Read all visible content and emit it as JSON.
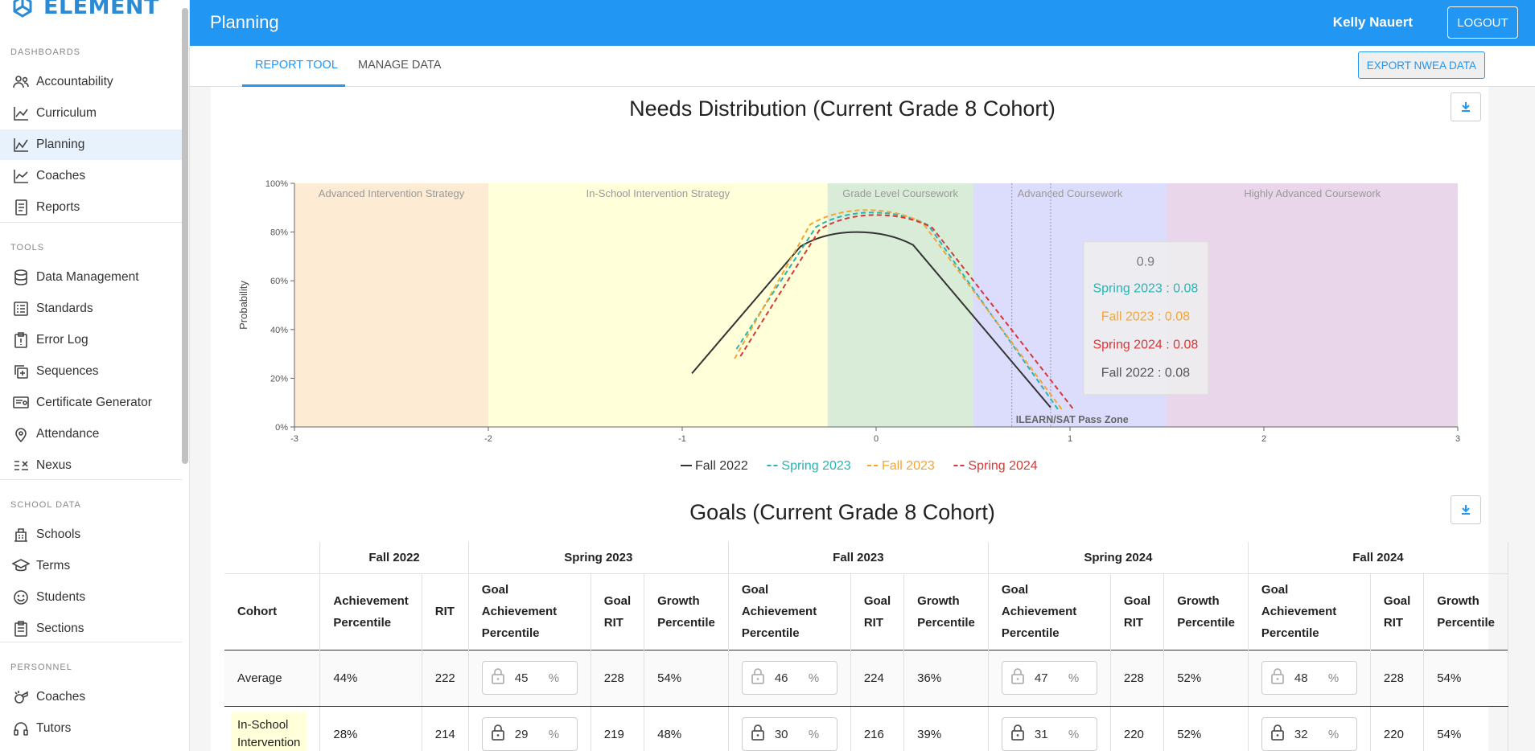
{
  "brand": {
    "name": "ELEMENT",
    "accent": "#2196f3",
    "logo_color": "#2a8ad4"
  },
  "sidebar": {
    "sections": [
      {
        "label": "DASHBOARDS",
        "items": [
          {
            "label": "Accountability",
            "icon": "people-icon"
          },
          {
            "label": "Curriculum",
            "icon": "line-chart-icon"
          },
          {
            "label": "Planning",
            "icon": "area-chart-icon",
            "active": true
          },
          {
            "label": "Coaches",
            "icon": "trend-chart-icon"
          },
          {
            "label": "Reports",
            "icon": "document-icon"
          }
        ]
      },
      {
        "label": "TOOLS",
        "items": [
          {
            "label": "Data Management",
            "icon": "database-icon"
          },
          {
            "label": "Standards",
            "icon": "list-icon"
          },
          {
            "label": "Error Log",
            "icon": "clipboard-alert-icon"
          },
          {
            "label": "Sequences",
            "icon": "stack-add-icon"
          },
          {
            "label": "Certificate Generator",
            "icon": "certificate-icon"
          },
          {
            "label": "Attendance",
            "icon": "location-pin-icon"
          },
          {
            "label": "Nexus",
            "icon": "sort-icon"
          }
        ]
      },
      {
        "label": "SCHOOL DATA",
        "items": [
          {
            "label": "Schools",
            "icon": "building-icon"
          },
          {
            "label": "Terms",
            "icon": "graduation-cap-icon"
          },
          {
            "label": "Students",
            "icon": "smiley-icon"
          },
          {
            "label": "Sections",
            "icon": "clipboard-icon"
          }
        ]
      },
      {
        "label": "PERSONNEL",
        "items": [
          {
            "label": "Coaches",
            "icon": "whistle-icon"
          },
          {
            "label": "Tutors",
            "icon": "headset-icon"
          }
        ]
      }
    ]
  },
  "header": {
    "title": "Planning",
    "user": "Kelly Nauert",
    "logout": "LOGOUT"
  },
  "tabs": [
    {
      "label": "REPORT TOOL",
      "active": true
    },
    {
      "label": "MANAGE DATA"
    }
  ],
  "export_button": "EXPORT NWEA DATA",
  "needs_chart_title": "Needs Distribution (Current Grade 8 Cohort)",
  "goals_title": "Goals (Current Grade 8 Cohort)",
  "chart_data": {
    "type": "line",
    "title": "Needs Distribution (Current Grade 8 Cohort)",
    "ylabel": "Probability",
    "xlabel": "",
    "xlim": [
      -3,
      3
    ],
    "ylim": [
      0,
      100
    ],
    "xticks": [
      "-3",
      "-2",
      "-1",
      "0",
      "1",
      "2",
      "3"
    ],
    "yticks": [
      "0%",
      "20%",
      "40%",
      "60%",
      "80%",
      "100%"
    ],
    "grid": false,
    "bands": [
      {
        "label": "Advanced Intervention Strategy",
        "from": -3,
        "to": -2,
        "color": "#fdebd3"
      },
      {
        "label": "In-School Intervention Strategy",
        "from": -2,
        "to": -0.25,
        "color": "#ffffd9"
      },
      {
        "label": "Grade Level Coursework",
        "from": -0.25,
        "to": 0.5,
        "color": "#d8ecd8"
      },
      {
        "label": "Advanced Coursework",
        "from": 0.5,
        "to": 1.5,
        "color": "#dcdcfc"
      },
      {
        "label": "Highly Advanced Coursework",
        "from": 1.5,
        "to": 3,
        "color": "#ead6ea"
      }
    ],
    "vertical_lines": [
      0.7,
      0.9
    ],
    "pass_zone_label": "ILEARN/SAT Pass Zone",
    "series": [
      {
        "name": "Fall 2022",
        "color": "#333333",
        "dashed": false,
        "x": [
          -0.95,
          -0.1,
          0.9
        ],
        "y": [
          22,
          80,
          8
        ]
      },
      {
        "name": "Spring 2023",
        "color": "#26b5b5",
        "dashed": true,
        "x": [
          -0.72,
          -0.02,
          0.94
        ],
        "y": [
          32,
          88,
          7
        ]
      },
      {
        "name": "Fall 2023",
        "color": "#f5a533",
        "dashed": true,
        "x": [
          -0.73,
          -0.05,
          0.96
        ],
        "y": [
          28,
          89,
          7
        ]
      },
      {
        "name": "Spring 2024",
        "color": "#d63838",
        "dashed": true,
        "x": [
          -0.7,
          0.0,
          1.02
        ],
        "y": [
          29,
          87,
          7
        ]
      }
    ],
    "tooltip": {
      "header": "0.9",
      "rows": [
        {
          "text": "Spring 2023 : 0.08",
          "color": "#26b5b5"
        },
        {
          "text": "Fall 2023 : 0.08",
          "color": "#f5a533"
        },
        {
          "text": "Spring 2024 : 0.08",
          "color": "#d63838"
        },
        {
          "text": "Fall 2022 : 0.08",
          "color": "#555555"
        }
      ]
    },
    "legend_position": "bottom"
  },
  "goals_table": {
    "terms": [
      "Fall 2022",
      "Spring 2023",
      "Fall 2023",
      "Spring 2024",
      "Fall 2024"
    ],
    "col_cohort": "Cohort",
    "col_achievement": "Achievement Percentile",
    "col_rit": "RIT",
    "col_goal_ach": "Goal Achievement Percentile",
    "col_goal_rit": "Goal RIT",
    "col_growth": "Growth Percentile",
    "rows": [
      {
        "cohort": "Average",
        "ach": "44%",
        "rit": "222",
        "goals": [
          {
            "goal": "45",
            "rit": "228",
            "growth": "54%"
          },
          {
            "goal": "46",
            "rit": "224",
            "growth": "36%"
          },
          {
            "goal": "47",
            "rit": "228",
            "growth": "52%"
          },
          {
            "goal": "48",
            "rit": "228",
            "growth": "54%"
          }
        ]
      },
      {
        "cohort": "In-School Intervention",
        "ach": "28%",
        "rit": "214",
        "goals": [
          {
            "goal": "29",
            "rit": "219",
            "growth": "48%"
          },
          {
            "goal": "30",
            "rit": "216",
            "growth": "39%"
          },
          {
            "goal": "31",
            "rit": "220",
            "growth": "52%"
          },
          {
            "goal": "32",
            "rit": "220",
            "growth": "54%"
          }
        ]
      }
    ],
    "pct_symbol": "%"
  }
}
